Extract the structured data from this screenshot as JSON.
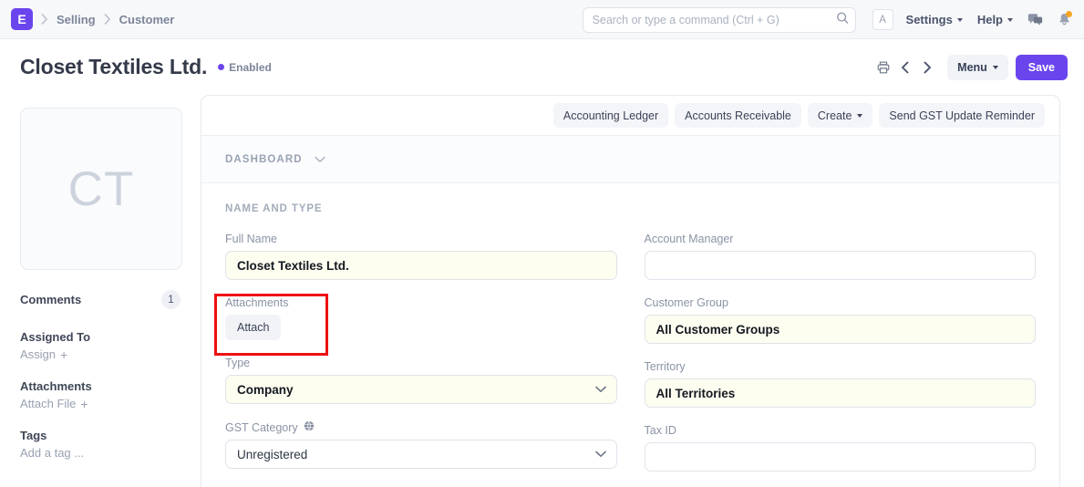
{
  "navbar": {
    "logo_letter": "E",
    "breadcrumbs": [
      {
        "label": "Selling"
      },
      {
        "label": "Customer"
      }
    ],
    "search": {
      "placeholder": "Search or type a command (Ctrl + G)",
      "value": "",
      "icon": "search-icon"
    },
    "avatar_letter": "A",
    "settings_label": "Settings",
    "help_label": "Help",
    "chat_icon": "comment-icon",
    "notification_icon": "bell-icon",
    "notification_dot_color": "#f5a623",
    "accent_color": "#6a45ee"
  },
  "page_head": {
    "title": "Closet Textiles Ltd.",
    "status_label": "Enabled",
    "status_color": "#6a45ee",
    "print_icon": "printer-icon",
    "prev_icon": "chevron-left-icon",
    "next_icon": "chevron-right-icon",
    "menu_label": "Menu",
    "save_label": "Save"
  },
  "sidebar": {
    "avatar_initials": "CT",
    "comments_label": "Comments",
    "comments_count": "1",
    "assigned_to_label": "Assigned To",
    "assign_action": "Assign",
    "attachments_label": "Attachments",
    "attach_file_action": "Attach File",
    "tags_label": "Tags",
    "add_tag_action": "Add a tag ..."
  },
  "actions": [
    {
      "label": "Accounting Ledger",
      "type": "button"
    },
    {
      "label": "Accounts Receivable",
      "type": "button"
    },
    {
      "label": "Create",
      "type": "dropdown"
    },
    {
      "label": "Send GST Update Reminder",
      "type": "button"
    }
  ],
  "dashboard": {
    "label": "DASHBOARD",
    "chevron_icon": "chevron-down-icon"
  },
  "form": {
    "section_label": "NAME AND TYPE",
    "left": {
      "full_name": {
        "label": "Full Name",
        "value": "Closet Textiles Ltd.",
        "modified": true
      },
      "attachments": {
        "label": "Attachments",
        "button_label": "Attach",
        "highlighted": true
      },
      "type": {
        "label": "Type",
        "value": "Company",
        "modified": true,
        "control": "select"
      },
      "gst_category": {
        "label": "GST Category",
        "info_icon": "globe-icon",
        "value": "Unregistered",
        "modified": false,
        "control": "select"
      }
    },
    "right": {
      "account_manager": {
        "label": "Account Manager",
        "value": "",
        "modified": false
      },
      "customer_group": {
        "label": "Customer Group",
        "value": "All Customer Groups",
        "modified": true
      },
      "territory": {
        "label": "Territory",
        "value": "All Territories",
        "modified": true
      },
      "tax_id": {
        "label": "Tax ID",
        "value": "",
        "modified": false
      }
    }
  },
  "annotation": {
    "color": "#ee1111",
    "target": "attachments-field"
  }
}
